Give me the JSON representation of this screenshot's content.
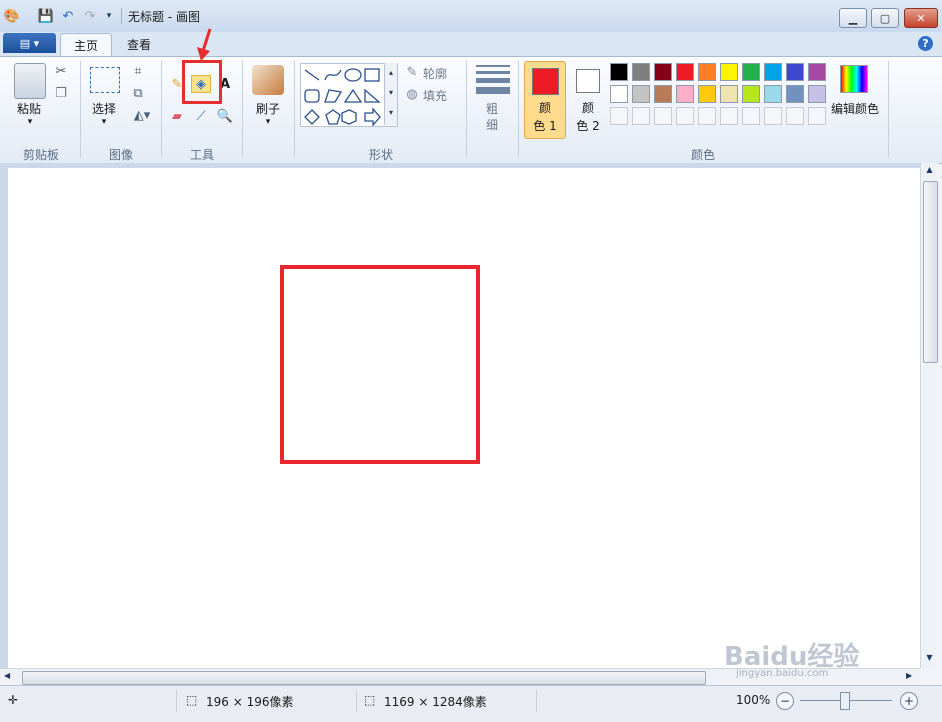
{
  "window": {
    "title": "无标题 - 画图"
  },
  "tabs": {
    "file": "▤ ▾",
    "home": "主页",
    "view": "查看",
    "help": "?"
  },
  "groups": {
    "clipboard": {
      "label": "剪贴板",
      "paste": "粘贴"
    },
    "image": {
      "label": "图像",
      "select": "选择"
    },
    "tools": {
      "label": "工具"
    },
    "brushes": {
      "label": "刷子"
    },
    "shapes": {
      "label": "形状",
      "outline": "轮廓",
      "fill": "填充"
    },
    "size": {
      "line1": "粗",
      "line2": "细"
    },
    "colors": {
      "label": "颜色",
      "color1_line1": "颜",
      "color1_line2": "色 1",
      "color2_line1": "颜",
      "color2_line2": "色 2",
      "edit": "编辑颜色"
    }
  },
  "palette": {
    "color1": "#ed1c24",
    "color2": "#ffffff",
    "row1": [
      "#000000",
      "#7f7f7f",
      "#880015",
      "#ed1c24",
      "#ff7f27",
      "#fff200",
      "#22b14c",
      "#00a2e8",
      "#3f48cc",
      "#a349a4"
    ],
    "row2": [
      "#ffffff",
      "#c3c3c3",
      "#b97a57",
      "#ffaec9",
      "#ffc90e",
      "#efe4b0",
      "#b5e61d",
      "#99d9ea",
      "#7092be",
      "#c8bfe7"
    ]
  },
  "canvas": {
    "square_color": "#e8262d",
    "highlight_color": "#e62e2e"
  },
  "status": {
    "selection_size": "196 × 196像素",
    "image_size": "1169 × 1284像素",
    "zoom": "100%"
  },
  "watermark": {
    "text": "Baidu经验",
    "sub": "jingyan.baidu.com"
  }
}
